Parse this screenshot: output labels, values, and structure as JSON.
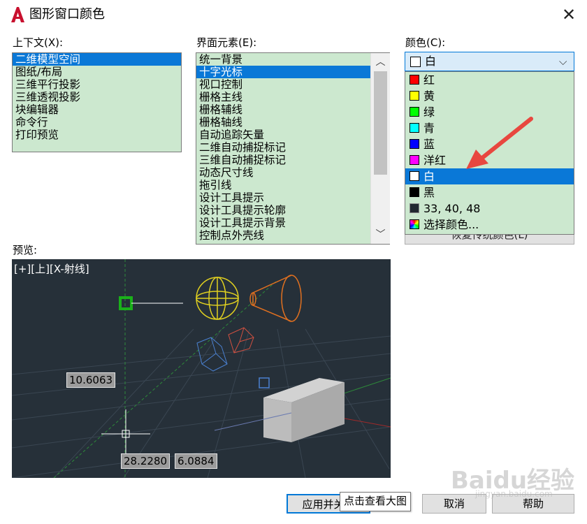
{
  "window": {
    "title": "图形窗口颜色",
    "close_glyph": "✕"
  },
  "context": {
    "label": "上下文(X):",
    "items": [
      "二维模型空间",
      "图纸/布局",
      "三维平行投影",
      "三维透视投影",
      "块编辑器",
      "命令行",
      "打印预览"
    ],
    "selected_index": 0
  },
  "interface_element": {
    "label": "界面元素(E):",
    "items": [
      "统一背景",
      "十字光标",
      "视口控制",
      "栅格主线",
      "栅格辅线",
      "栅格轴线",
      "自动追踪矢量",
      "二维自动捕捉标记",
      "三维自动捕捉标记",
      "动态尺寸线",
      "拖引线",
      "设计工具提示",
      "设计工具提示轮廓",
      "设计工具提示背景",
      "控制点外壳线"
    ],
    "selected_index": 1
  },
  "color": {
    "label": "颜色(C):",
    "current": "白",
    "current_color": "#ffffff",
    "options": [
      {
        "label": "红",
        "color": "#ff0000"
      },
      {
        "label": "黄",
        "color": "#ffff00"
      },
      {
        "label": "绿",
        "color": "#00ff00"
      },
      {
        "label": "青",
        "color": "#00ffff"
      },
      {
        "label": "蓝",
        "color": "#0000ff"
      },
      {
        "label": "洋红",
        "color": "#ff00ff"
      },
      {
        "label": "白",
        "color": "#ffffff"
      },
      {
        "label": "黑",
        "color": "#000000"
      },
      {
        "label": "33, 40, 48",
        "color": "#212830"
      },
      {
        "label": "选择颜色...",
        "color": "rainbow"
      }
    ],
    "selected_index": 6
  },
  "restore_button": "恢复传统颜色(L)",
  "preview": {
    "label": "预览:",
    "viewport_label": "[+][上][X-射线]",
    "dim_values": [
      "10.6063",
      "28.2280",
      "6.0884"
    ],
    "background": "#263039"
  },
  "buttons": {
    "apply_close": "应用并关闭",
    "cancel": "取消",
    "help": "帮助"
  },
  "tooltip": "点击查看大图",
  "watermark": {
    "brand": "Baidu经验",
    "url": "jingyan.baidu.com"
  },
  "accent_color": "#0a78d7",
  "list_bg_color": "#cce8cf"
}
